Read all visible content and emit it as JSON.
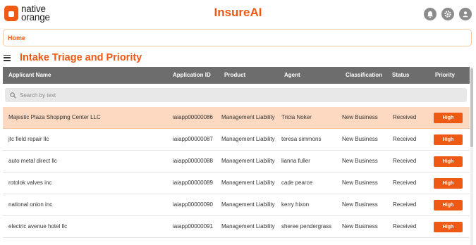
{
  "brand": {
    "logo_line1": "native",
    "logo_line2": "orange",
    "app_title": "InsureAI",
    "accent": "#ee5a14"
  },
  "header_icons": [
    "bell-icon",
    "gear-icon",
    "user-icon"
  ],
  "breadcrumb": {
    "home": "Home"
  },
  "page": {
    "title": "Intake Triage and Priority"
  },
  "search": {
    "placeholder": "Search by text",
    "value": ""
  },
  "table": {
    "columns": [
      "Applicant Name",
      "Application ID",
      "Product",
      "Agent",
      "Classification",
      "Status",
      "Priority"
    ],
    "rows": [
      {
        "name": "Majestic Plaza Shopping Center LLC",
        "id": "iaiapp00000086",
        "product": "Management Liability",
        "agent": "Tricia Noker",
        "classification": "New Business",
        "status": "Received",
        "priority": "High"
      },
      {
        "name": "jtc field repair llc",
        "id": "iaiapp00000087",
        "product": "Management Liability",
        "agent": "teresa simmons",
        "classification": "New Business",
        "status": "Received",
        "priority": "High"
      },
      {
        "name": "auto metal direct llc",
        "id": "iaiapp00000088",
        "product": "Management Liability",
        "agent": "lianna fuller",
        "classification": "New Business",
        "status": "Received",
        "priority": "High"
      },
      {
        "name": "rotolok valves inc",
        "id": "iaiapp00000089",
        "product": "Management Liability",
        "agent": "cade pearce",
        "classification": "New Business",
        "status": "Received",
        "priority": "High"
      },
      {
        "name": "national onion inc",
        "id": "iaiapp00000090",
        "product": "Management Liability",
        "agent": "kerry hixon",
        "classification": "New Business",
        "status": "Received",
        "priority": "High"
      },
      {
        "name": "electric avenue hotel llc",
        "id": "iaiapp00000091",
        "product": "Management Liability",
        "agent": "sheree pendergrass",
        "classification": "New Business",
        "status": "Received",
        "priority": "High"
      }
    ]
  }
}
